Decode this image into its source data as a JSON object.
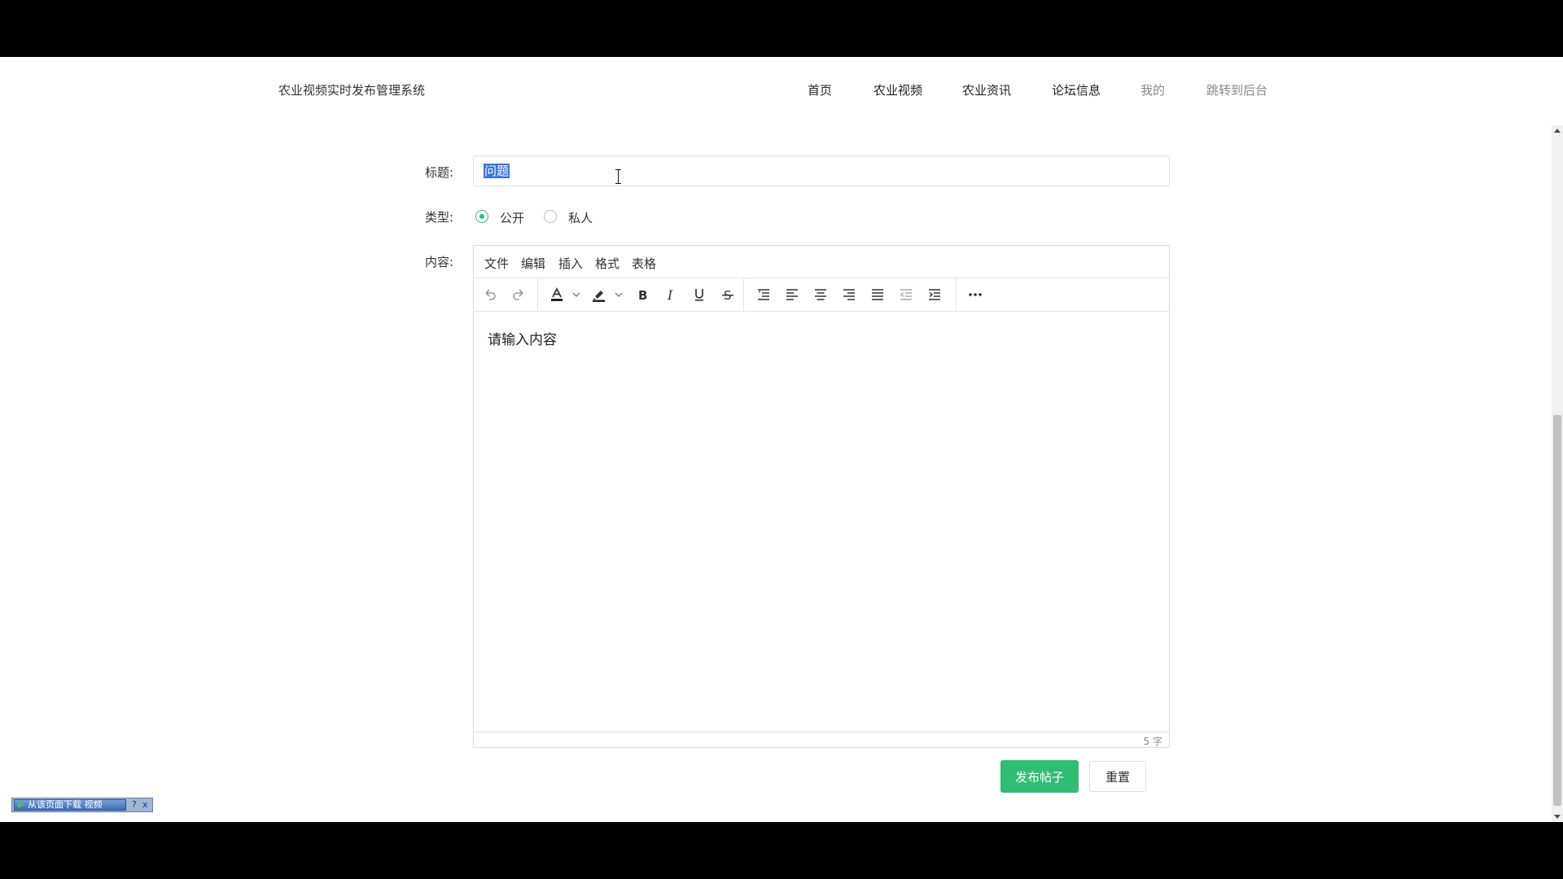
{
  "header": {
    "brand": "农业视频实时发布管理系统",
    "nav": [
      "首页",
      "农业视频",
      "农业资讯",
      "论坛信息",
      "我的",
      "跳转到后台"
    ]
  },
  "form": {
    "title_label": "标题:",
    "title_value": "问题",
    "type_label": "类型:",
    "type_options": [
      {
        "label": "公开",
        "checked": true
      },
      {
        "label": "私人",
        "checked": false
      }
    ],
    "content_label": "内容:"
  },
  "editor": {
    "menu": [
      "文件",
      "编辑",
      "插入",
      "格式",
      "表格"
    ],
    "content": "请输入内容",
    "word_count": "5 字"
  },
  "buttons": {
    "publish": "发布帖子",
    "reset": "重置"
  },
  "download_widget": {
    "label": "从该页面下载 视频",
    "help": "?",
    "close": "x"
  },
  "colors": {
    "accent": "#2fbd76",
    "selection": "#3a74d8"
  }
}
